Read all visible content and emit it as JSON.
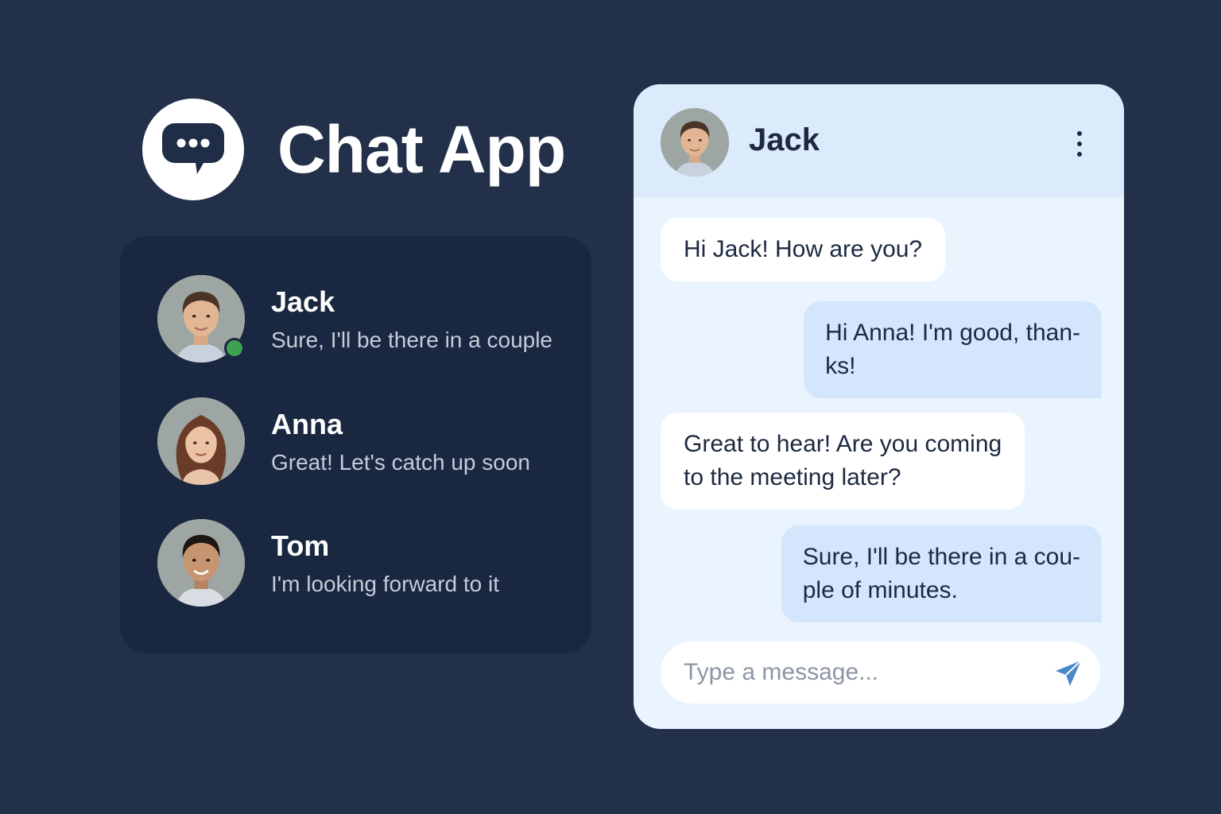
{
  "app": {
    "title": "Chat App",
    "logo_icon": "chat-bubble-icon"
  },
  "colors": {
    "background": "#22304a",
    "panel": "#1a2740",
    "chat_background": "#eaf4fe",
    "header_background": "#dcebfb",
    "incoming_bubble": "#ffffff",
    "outgoing_bubble": "#d3e6fb",
    "online": "#3ea052",
    "send_icon": "#4a88c7"
  },
  "contacts": [
    {
      "name": "Jack",
      "preview": "Sure, I'll be there in a couple",
      "online": true
    },
    {
      "name": "Anna",
      "preview": "Great! Let's catch up soon",
      "online": false
    },
    {
      "name": "Tom",
      "preview": "I'm looking forward to it",
      "online": false
    }
  ],
  "chat": {
    "contact_name": "Jack",
    "menu_icon": "more-vertical-icon",
    "messages": [
      {
        "direction": "incoming",
        "lines": [
          "Hi Jack! How are you?"
        ]
      },
      {
        "direction": "outgoing",
        "lines": [
          "Hi Anna! I'm good, than-",
          "ks!"
        ]
      },
      {
        "direction": "incoming",
        "lines": [
          "Great to hear! Are you coming",
          "to the meeting later?"
        ]
      },
      {
        "direction": "outgoing",
        "lines": [
          "Sure, I'll be there in a cou-",
          "ple of minutes."
        ]
      }
    ]
  },
  "composer": {
    "value": "",
    "placeholder": "Type a message...",
    "send_icon": "send-icon"
  }
}
